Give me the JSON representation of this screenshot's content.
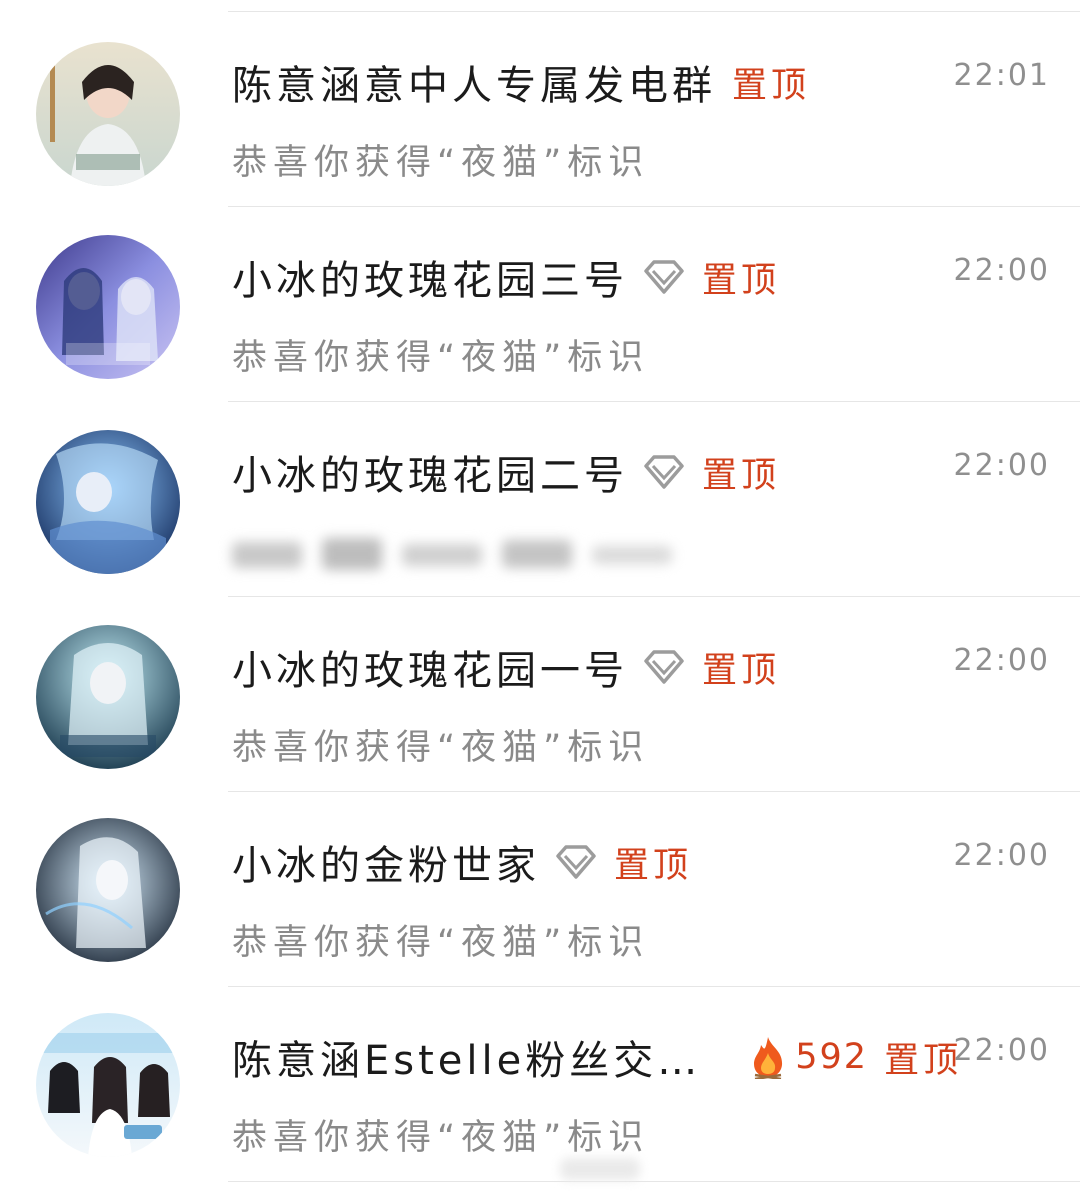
{
  "chats": [
    {
      "name": "陈意涵意中人专属发电群",
      "badge": "",
      "heat": "",
      "pinned": "置顶",
      "time": "22:01",
      "preview": "恭喜你获得“夜猫”标识",
      "preview_blurred": false,
      "avatar": "portrait-avatar-gold"
    },
    {
      "name": "小冰的玫瑰花园三号",
      "badge": "diamond-icon",
      "heat": "",
      "pinned": "置顶",
      "time": "22:00",
      "preview": "恭喜你获得“夜猫”标识",
      "preview_blurred": false,
      "avatar": "anniversary-avatar-purple"
    },
    {
      "name": "小冰的玫瑰花园二号",
      "badge": "diamond-icon",
      "heat": "",
      "pinned": "置顶",
      "time": "22:00",
      "preview": "",
      "preview_blurred": true,
      "avatar": "anniversary-avatar-blue"
    },
    {
      "name": "小冰的玫瑰花园一号",
      "badge": "diamond-icon",
      "heat": "",
      "pinned": "置顶",
      "time": "22:00",
      "preview": "恭喜你获得“夜猫”标识",
      "preview_blurred": false,
      "avatar": "anniversary-avatar-teal"
    },
    {
      "name": "小冰的金粉世家",
      "badge": "diamond-icon",
      "heat": "",
      "pinned": "置顶",
      "time": "22:00",
      "preview": "恭喜你获得“夜猫”标识",
      "preview_blurred": false,
      "avatar": "ice-avatar-dark"
    },
    {
      "name": "陈意涵Estelle粉丝交…",
      "badge": "fire-icon",
      "heat": "592",
      "pinned": "置顶",
      "time": "22:00",
      "preview": "恭喜你获得“夜猫”标识",
      "preview_blurred": false,
      "avatar": "group-photo-avatar"
    }
  ],
  "colors": {
    "pinned": "#d2411c",
    "time": "#8f8f8f",
    "preview": "#8a8a8a",
    "name": "#1b1b1b",
    "divider": "#e6e6e6"
  }
}
